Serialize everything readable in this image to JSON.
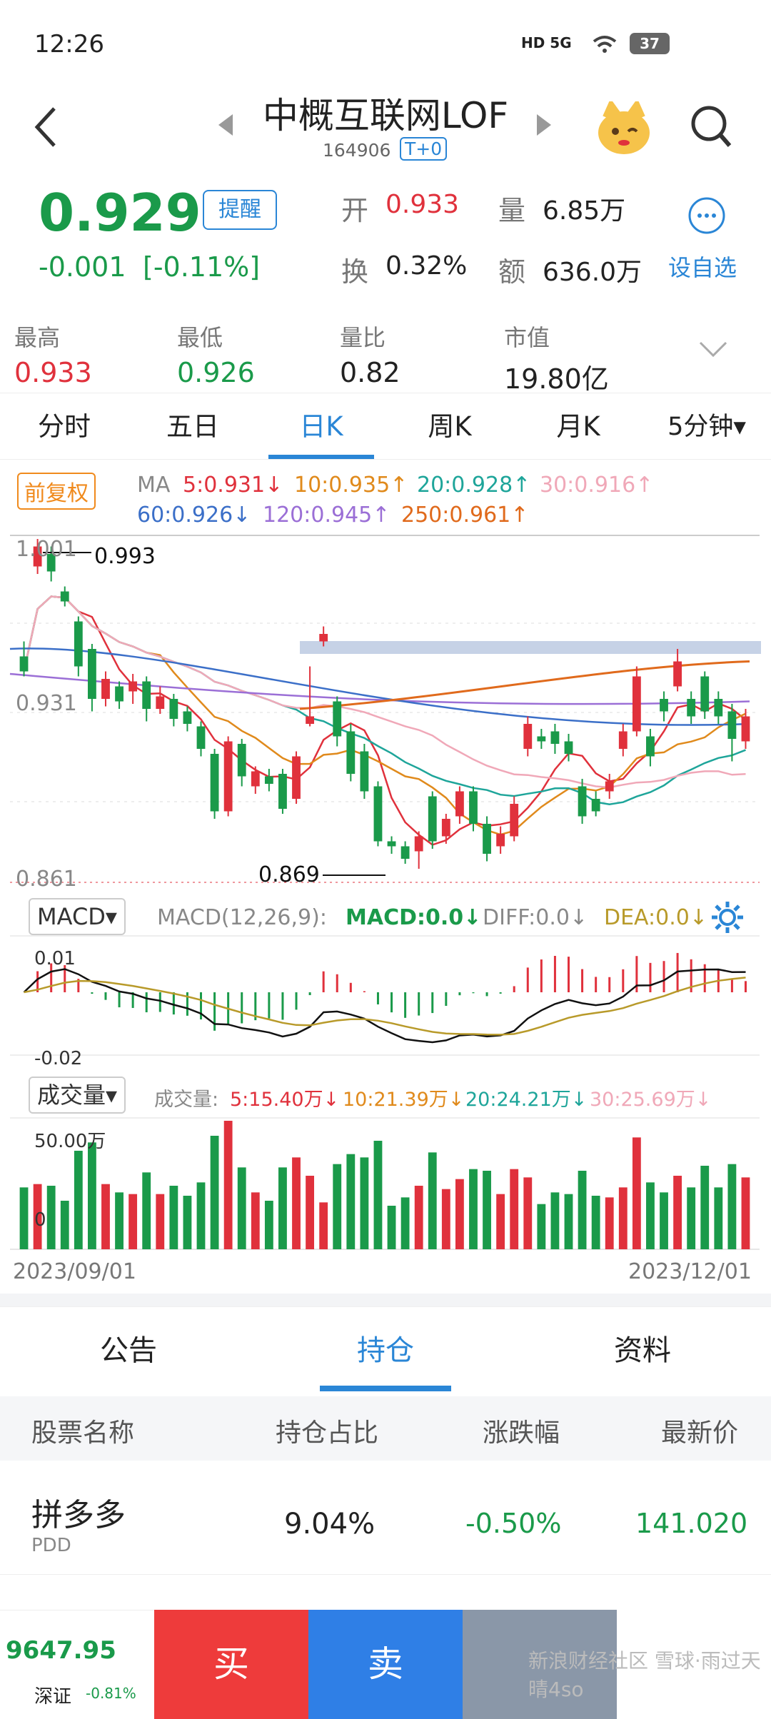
{
  "status_bar": {
    "time": "12:26",
    "icons": "HD 5G",
    "battery": "37"
  },
  "header": {
    "title": "中概互联网LOF",
    "code": "164906",
    "badge": "T+0"
  },
  "quote": {
    "price": "0.929",
    "change": "-0.001",
    "change_pct": "[-0.11%]",
    "alert_label": "提醒",
    "open_label": "开",
    "open_value": "0.933",
    "volume_label": "量",
    "volume_value": "6.85万",
    "turnover_label": "换",
    "turnover_value": "0.32%",
    "amount_label": "额",
    "amount_value": "636.0万",
    "watch_label": "设自选"
  },
  "stats": [
    {
      "label": "最高",
      "value": "0.933"
    },
    {
      "label": "最低",
      "value": "0.926"
    },
    {
      "label": "量比",
      "value": "0.82"
    },
    {
      "label": "市值",
      "value": "19.80亿"
    }
  ],
  "tabs": [
    "分时",
    "五日",
    "日K",
    "周K",
    "月K",
    "5分钟▾"
  ],
  "ma": {
    "adjust_label": "前复权",
    "prefix": "MA",
    "ma5": "5:0.931↓",
    "ma10": "10:0.935↑",
    "ma20": "20:0.928↑",
    "ma30": "30:0.916↑",
    "ma60": "60:0.926↓",
    "ma120": "120:0.945↑",
    "ma250": "250:0.961↑"
  },
  "price_axis": {
    "top": "1.001",
    "mid": "0.931",
    "bottom": "0.861",
    "hi_mark": "0.993",
    "lo_mark": "0.869"
  },
  "macd": {
    "selector": "MACD",
    "label": "MACD(12,26,9):",
    "macd": "MACD:0.0↓",
    "diff": "DIFF:0.0↓",
    "dea": "DEA:0.0↓",
    "axis_top": "0.01",
    "axis_bottom": "-0.02"
  },
  "volume": {
    "selector": "成交量",
    "label": "成交量:",
    "v5": "5:15.40万↓",
    "v10": "10:21.39万↓",
    "v20": "20:24.21万↓",
    "v30": "30:25.69万↓",
    "axis_top": "50.00万",
    "axis_zero": "0"
  },
  "dates": {
    "start": "2023/09/01",
    "end": "2023/12/01"
  },
  "bottom_tabs": [
    "公告",
    "持仓",
    "资料"
  ],
  "table": {
    "headers": [
      "股票名称",
      "持仓占比",
      "涨跌幅",
      "最新价"
    ],
    "rows": [
      {
        "name": "拼多多",
        "code": "PDD",
        "weight": "9.04%",
        "change": "-0.50%",
        "price": "141.020"
      }
    ]
  },
  "bottom_bar": {
    "index_value": "9647.95",
    "index_name": "深证",
    "index_change": "-0.81%",
    "buy": "买",
    "sell": "卖",
    "watermark": "新浪财经社区 雪球·雨过天晴4so"
  },
  "colors": {
    "up": "#e0313c",
    "down": "#1a9a4a",
    "accent": "#2a86d6"
  },
  "chart_data": {
    "type": "candlestick",
    "x_range": [
      "2023/09/01",
      "2023/12/01"
    ],
    "ylim": [
      0.861,
      1.001
    ],
    "candles": [
      {
        "o": 0.952,
        "c": 0.946,
        "h": 0.958,
        "l": 0.944
      },
      {
        "o": 0.988,
        "c": 0.996,
        "h": 0.999,
        "l": 0.985
      },
      {
        "o": 0.993,
        "c": 0.986,
        "h": 0.996,
        "l": 0.982
      },
      {
        "o": 0.978,
        "c": 0.974,
        "h": 0.98,
        "l": 0.972
      },
      {
        "o": 0.966,
        "c": 0.948,
        "h": 0.968,
        "l": 0.944
      },
      {
        "o": 0.955,
        "c": 0.935,
        "h": 0.957,
        "l": 0.93
      },
      {
        "o": 0.935,
        "c": 0.943,
        "h": 0.946,
        "l": 0.932
      },
      {
        "o": 0.94,
        "c": 0.934,
        "h": 0.942,
        "l": 0.931
      },
      {
        "o": 0.938,
        "c": 0.942,
        "h": 0.945,
        "l": 0.933
      },
      {
        "o": 0.942,
        "c": 0.931,
        "h": 0.944,
        "l": 0.926
      },
      {
        "o": 0.931,
        "c": 0.936,
        "h": 0.94,
        "l": 0.929
      },
      {
        "o": 0.935,
        "c": 0.927,
        "h": 0.937,
        "l": 0.924
      },
      {
        "o": 0.93,
        "c": 0.925,
        "h": 0.932,
        "l": 0.922
      },
      {
        "o": 0.924,
        "c": 0.915,
        "h": 0.926,
        "l": 0.912
      },
      {
        "o": 0.913,
        "c": 0.89,
        "h": 0.915,
        "l": 0.887
      },
      {
        "o": 0.89,
        "c": 0.918,
        "h": 0.92,
        "l": 0.888
      },
      {
        "o": 0.917,
        "c": 0.904,
        "h": 0.919,
        "l": 0.9
      },
      {
        "o": 0.9,
        "c": 0.906,
        "h": 0.908,
        "l": 0.897
      },
      {
        "o": 0.904,
        "c": 0.901,
        "h": 0.907,
        "l": 0.898
      },
      {
        "o": 0.905,
        "c": 0.891,
        "h": 0.907,
        "l": 0.889
      },
      {
        "o": 0.895,
        "c": 0.912,
        "h": 0.914,
        "l": 0.893
      },
      {
        "o": 0.925,
        "c": 0.928,
        "h": 0.948,
        "l": 0.924
      },
      {
        "o": 0.958,
        "c": 0.961,
        "h": 0.964,
        "l": 0.956
      },
      {
        "o": 0.934,
        "c": 0.92,
        "h": 0.936,
        "l": 0.916
      },
      {
        "o": 0.922,
        "c": 0.905,
        "h": 0.925,
        "l": 0.902
      },
      {
        "o": 0.914,
        "c": 0.898,
        "h": 0.917,
        "l": 0.895
      },
      {
        "o": 0.9,
        "c": 0.878,
        "h": 0.902,
        "l": 0.876
      },
      {
        "o": 0.878,
        "c": 0.876,
        "h": 0.88,
        "l": 0.873
      },
      {
        "o": 0.876,
        "c": 0.871,
        "h": 0.878,
        "l": 0.869
      },
      {
        "o": 0.874,
        "c": 0.88,
        "h": 0.882,
        "l": 0.867
      },
      {
        "o": 0.896,
        "c": 0.878,
        "h": 0.898,
        "l": 0.875
      },
      {
        "o": 0.88,
        "c": 0.887,
        "h": 0.889,
        "l": 0.877
      },
      {
        "o": 0.888,
        "c": 0.898,
        "h": 0.9,
        "l": 0.885
      },
      {
        "o": 0.898,
        "c": 0.885,
        "h": 0.9,
        "l": 0.882
      },
      {
        "o": 0.885,
        "c": 0.873,
        "h": 0.888,
        "l": 0.87
      },
      {
        "o": 0.876,
        "c": 0.881,
        "h": 0.884,
        "l": 0.873
      },
      {
        "o": 0.88,
        "c": 0.893,
        "h": 0.896,
        "l": 0.878
      },
      {
        "o": 0.915,
        "c": 0.925,
        "h": 0.928,
        "l": 0.912
      },
      {
        "o": 0.92,
        "c": 0.918,
        "h": 0.923,
        "l": 0.915
      },
      {
        "o": 0.922,
        "c": 0.917,
        "h": 0.925,
        "l": 0.913
      },
      {
        "o": 0.918,
        "c": 0.913,
        "h": 0.921,
        "l": 0.91
      },
      {
        "o": 0.9,
        "c": 0.888,
        "h": 0.903,
        "l": 0.885
      },
      {
        "o": 0.895,
        "c": 0.89,
        "h": 0.898,
        "l": 0.888
      },
      {
        "o": 0.898,
        "c": 0.902,
        "h": 0.905,
        "l": 0.895
      },
      {
        "o": 0.915,
        "c": 0.922,
        "h": 0.925,
        "l": 0.912
      },
      {
        "o": 0.922,
        "c": 0.944,
        "h": 0.948,
        "l": 0.92
      },
      {
        "o": 0.92,
        "c": 0.912,
        "h": 0.923,
        "l": 0.908
      },
      {
        "o": 0.935,
        "c": 0.93,
        "h": 0.938,
        "l": 0.926
      },
      {
        "o": 0.94,
        "c": 0.95,
        "h": 0.955,
        "l": 0.938
      },
      {
        "o": 0.935,
        "c": 0.928,
        "h": 0.938,
        "l": 0.925
      },
      {
        "o": 0.944,
        "c": 0.93,
        "h": 0.946,
        "l": 0.927
      },
      {
        "o": 0.935,
        "c": 0.928,
        "h": 0.938,
        "l": 0.925
      },
      {
        "o": 0.93,
        "c": 0.919,
        "h": 0.933,
        "l": 0.91
      },
      {
        "o": 0.918,
        "c": 0.928,
        "h": 0.931,
        "l": 0.915
      }
    ]
  }
}
